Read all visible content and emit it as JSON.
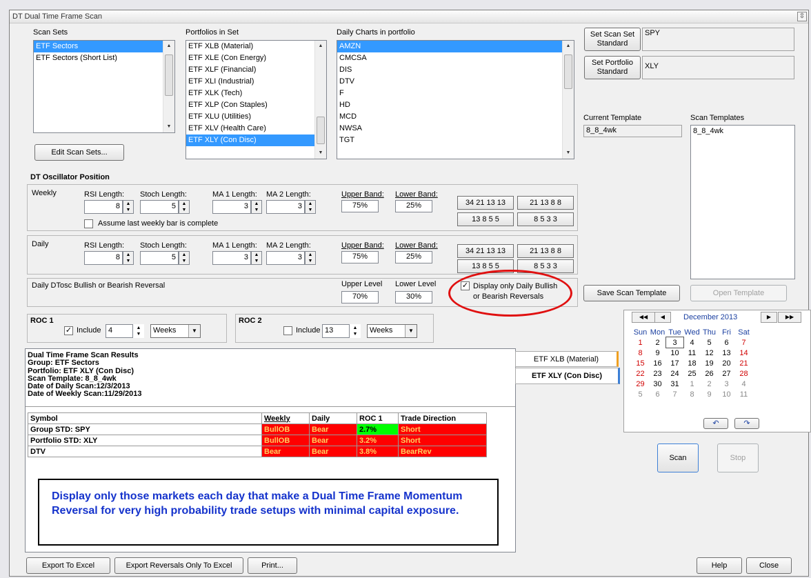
{
  "window": {
    "title": "DT Dual Time Frame Scan",
    "restore_glyph": "⇳"
  },
  "scan_sets": {
    "label": "Scan Sets",
    "items": [
      "ETF Sectors",
      "ETF Sectors (Short List)"
    ],
    "selected": 0,
    "edit_button": "Edit Scan Sets..."
  },
  "portfolios": {
    "label": "Portfolios in Set",
    "items": [
      "ETF XLB (Material)",
      "ETF XLE (Con Energy)",
      "ETF XLF (Financial)",
      "ETF XLI (Industrial)",
      "ETF XLK (Tech)",
      "ETF XLP (Con Staples)",
      "ETF XLU (Utilities)",
      "ETF XLV (Health Care)",
      "ETF XLY (Con Disc)"
    ],
    "selected": 8
  },
  "daily_charts": {
    "label": "Daily Charts in portfolio",
    "items": [
      "AMZN",
      "CMCSA",
      "DIS",
      "DTV",
      "F",
      "HD",
      "MCD",
      "NWSA",
      "TGT"
    ],
    "selected": 0
  },
  "standards": {
    "set_scan_set_button": "Set Scan Set\nStandard",
    "scan_set_value": "SPY",
    "set_portfolio_button": "Set Portfolio\nStandard",
    "portfolio_value": "XLY"
  },
  "templates": {
    "current_label": "Current Template",
    "current_value": "8_8_4wk",
    "scan_label": "Scan Templates",
    "items": [
      "8_8_4wk"
    ],
    "save_button": "Save Scan Template",
    "open_button": "Open Template"
  },
  "oscillator": {
    "section_label": "DT Oscillator Position",
    "weekly": {
      "label": "Weekly",
      "rsi_label": "RSI Length:",
      "rsi": "8",
      "stoch_label": "Stoch Length:",
      "stoch": "5",
      "ma1_label": "MA 1 Length:",
      "ma1": "3",
      "ma2_label": "MA 2 Length:",
      "ma2": "3",
      "upper_label": "Upper Band:",
      "upper": "75%",
      "lower_label": "Lower Band:",
      "lower": "25%",
      "presets": [
        "34 21 13 13",
        "21 13 8 8",
        "13 8 5 5",
        "8 5 3 3"
      ],
      "assume_label": "Assume last weekly bar is complete"
    },
    "daily": {
      "label": "Daily",
      "rsi_label": "RSI Length:",
      "rsi": "8",
      "stoch_label": "Stoch Length:",
      "stoch": "5",
      "ma1_label": "MA 1 Length:",
      "ma1": "3",
      "ma2_label": "MA 2 Length:",
      "ma2": "3",
      "upper_label": "Upper Band:",
      "upper": "75%",
      "lower_label": "Lower Band:",
      "lower": "25%",
      "presets": [
        "34 21 13 13",
        "21 13 8 8",
        "13 8 5 5",
        "8 5 3 3"
      ]
    },
    "reversal": {
      "label": "Daily DTosc Bullish or Bearish Reversal",
      "upper_label": "Upper Level",
      "upper": "70%",
      "lower_label": "Lower Level",
      "lower": "30%",
      "display_only_label": "Display only Daily Bullish\nor Bearish Reversals",
      "display_only_checked": true
    }
  },
  "roc1": {
    "label": "ROC 1",
    "include_label": "Include",
    "include_checked": true,
    "value": "4",
    "period": "Weeks"
  },
  "roc2": {
    "label": "ROC 2",
    "include_label": "Include",
    "include_checked": false,
    "value": "13",
    "period": "Weeks"
  },
  "results": {
    "header_lines": [
      "Dual Time Frame Scan Results",
      "Group: ETF Sectors",
      "Portfolio: ETF XLY (Con Disc)",
      "Scan Template: 8_8_4wk",
      "Date of Daily Scan:12/3/2013",
      "Date of Weekly Scan:11/29/2013"
    ],
    "columns": [
      "Symbol",
      "Weekly",
      "Daily",
      "ROC 1",
      "Trade Direction"
    ],
    "rows": [
      {
        "symbol": "Group STD: SPY",
        "weekly": "BullOB",
        "daily": "Bear",
        "roc": "2.7%",
        "direction": "Short",
        "roc_color": "#00ff00"
      },
      {
        "symbol": "Portfolio STD: XLY",
        "weekly": "BullOB",
        "daily": "Bear",
        "roc": "3.2%",
        "direction": "Short",
        "roc_color": "#ff0000"
      },
      {
        "symbol": "DTV",
        "weekly": "Bear",
        "daily": "Bear",
        "roc": "3.8%",
        "direction": "BearRev",
        "roc_color": "#ff0000"
      }
    ],
    "callout": "Display only those markets each day that make a Dual Time Frame Momentum Reversal for very high probability trade setups with minimal capital exposure."
  },
  "result_tabs": [
    "ETF XLB (Material)",
    "ETF XLY (Con Disc)"
  ],
  "calendar": {
    "month_label": "December 2013",
    "nav": [
      "◀◀",
      "◀",
      "▶",
      "▶▶"
    ],
    "weekdays": [
      "Sun",
      "Mon",
      "Tue",
      "Wed",
      "Thu",
      "Fri",
      "Sat"
    ],
    "weeks": [
      [
        "1",
        "2",
        "3",
        "4",
        "5",
        "6",
        "7"
      ],
      [
        "8",
        "9",
        "10",
        "11",
        "12",
        "13",
        "14"
      ],
      [
        "15",
        "16",
        "17",
        "18",
        "19",
        "20",
        "21"
      ],
      [
        "22",
        "23",
        "24",
        "25",
        "26",
        "27",
        "28"
      ],
      [
        "29",
        "30",
        "31",
        "1",
        "2",
        "3",
        "4"
      ],
      [
        "5",
        "6",
        "7",
        "8",
        "9",
        "10",
        "11"
      ]
    ],
    "today": "3",
    "bottom_buttons": [
      "↶",
      "↷"
    ]
  },
  "actions": {
    "scan": "Scan",
    "stop": "Stop",
    "export_excel": "Export To Excel",
    "export_reversals": "Export Reversals Only To Excel",
    "print": "Print...",
    "help": "Help",
    "close": "Close"
  }
}
